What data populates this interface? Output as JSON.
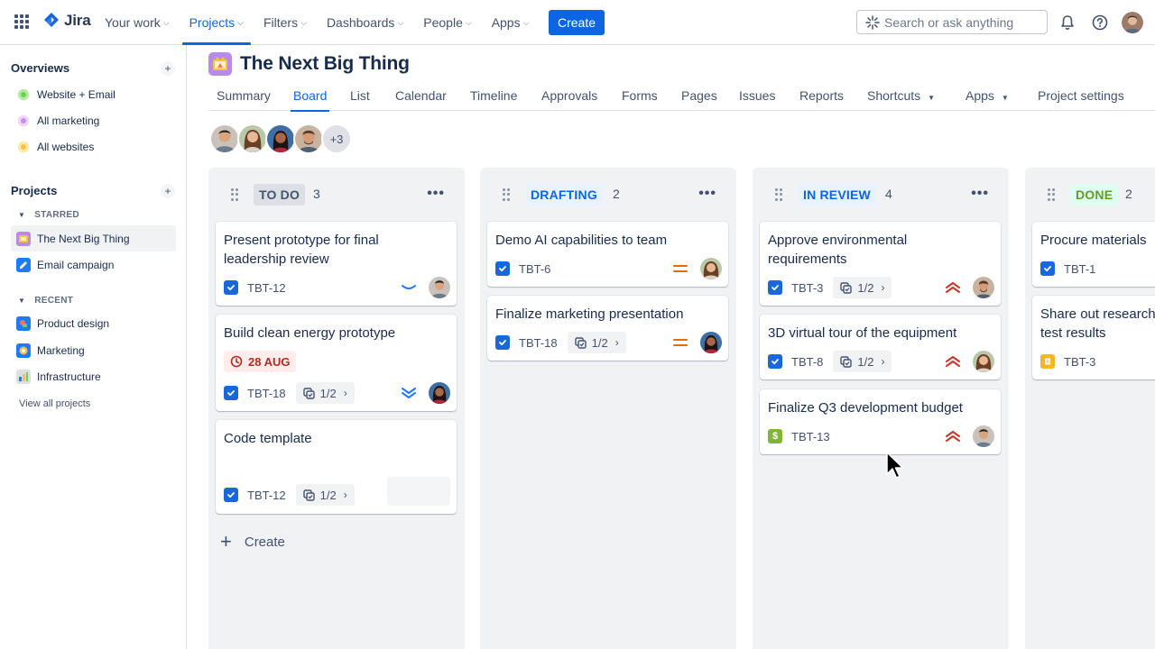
{
  "nav": {
    "logo_text": "Jira",
    "items": [
      {
        "label": "Your work"
      },
      {
        "label": "Projects",
        "active": true
      },
      {
        "label": "Filters"
      },
      {
        "label": "Dashboards"
      },
      {
        "label": "People"
      },
      {
        "label": "Apps"
      }
    ],
    "create_label": "Create",
    "search_placeholder": "Search or ask anything"
  },
  "sidebar": {
    "overviews_heading": "Overviews",
    "overviews": [
      {
        "label": "Website + Email",
        "color": "#6bcf5a"
      },
      {
        "label": "All marketing",
        "color": "#c98bf0"
      },
      {
        "label": "All websites",
        "color": "#f5c443"
      }
    ],
    "projects_heading": "Projects",
    "starred_label": "STARRED",
    "starred": [
      {
        "label": "The Next Big Thing",
        "selected": true
      },
      {
        "label": "Email campaign"
      }
    ],
    "recent_label": "RECENT",
    "recent": [
      {
        "label": "Product design"
      },
      {
        "label": "Marketing"
      },
      {
        "label": "Infrastructure"
      }
    ],
    "view_all": "View all projects"
  },
  "project": {
    "title": "The Next Big Thing",
    "tabs": [
      {
        "label": "Summary"
      },
      {
        "label": "Board",
        "active": true
      },
      {
        "label": "List"
      },
      {
        "label": "Calendar"
      },
      {
        "label": "Timeline"
      },
      {
        "label": "Approvals"
      },
      {
        "label": "Forms"
      },
      {
        "label": "Pages"
      },
      {
        "label": "Issues"
      },
      {
        "label": "Reports"
      },
      {
        "label": "Shortcuts",
        "dropdown": true
      },
      {
        "label": "Apps",
        "dropdown": true
      },
      {
        "label": "Project settings"
      }
    ],
    "extra_members": "+3"
  },
  "board": {
    "create_label": "Create",
    "columns": [
      {
        "title": "TO DO",
        "count": "3",
        "title_bg": "#dcdfe4",
        "title_color": "#44546f",
        "cards": [
          {
            "title": "Present prototype for final leadership review",
            "key": "TBT-12",
            "priority": "low"
          },
          {
            "title": "Build clean energy prototype",
            "due": "28 AUG",
            "key": "TBT-18",
            "subtasks": "1/2",
            "priority": "lowest"
          },
          {
            "title": "Code template",
            "key": "TBT-12",
            "subtasks": "1/2"
          }
        ]
      },
      {
        "title": "DRAFTING",
        "count": "2",
        "title_bg": "#e9f2ff",
        "title_color": "#0c66e4",
        "cards": [
          {
            "title": "Demo AI capabilities to team",
            "key": "TBT-6",
            "priority": "medium"
          },
          {
            "title": "Finalize marketing presentation",
            "key": "TBT-18",
            "subtasks": "1/2",
            "priority": "medium"
          }
        ]
      },
      {
        "title": "IN REVIEW",
        "count": "4",
        "title_bg": "#e9f2ff",
        "title_color": "#0c66e4",
        "cards": [
          {
            "title": "Approve environmental requirements",
            "key": "TBT-3",
            "subtasks": "1/2",
            "priority": "high"
          },
          {
            "title": "3D virtual tour of the equipment",
            "key": "TBT-8",
            "subtasks": "1/2",
            "priority": "high"
          },
          {
            "title": "Finalize Q3 development budget",
            "key": "TBT-13",
            "priority": "high"
          }
        ]
      },
      {
        "title": "DONE",
        "count": "2",
        "title_bg": "#dcfff1",
        "title_color": "#6a9a23",
        "cards": [
          {
            "title": "Procure materials",
            "key": "TBT-1"
          },
          {
            "title": "Share out research test results",
            "key": "TBT-3"
          }
        ]
      }
    ]
  },
  "colors": {
    "accent": "#0c66e4",
    "checkbox": "#1868db",
    "priority_high": "#c9372c",
    "priority_medium": "#d97008",
    "priority_low": "#1d7afc"
  }
}
